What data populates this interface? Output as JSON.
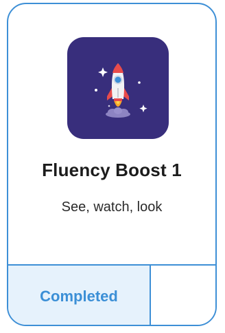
{
  "card": {
    "icon": "rocket-icon",
    "title": "Fluency Boost 1",
    "subtitle": "See, watch, look",
    "status_label": "Completed"
  },
  "colors": {
    "accent": "#3d8fd6",
    "icon_background": "#382e7c",
    "status_background": "#e6f2fc"
  }
}
